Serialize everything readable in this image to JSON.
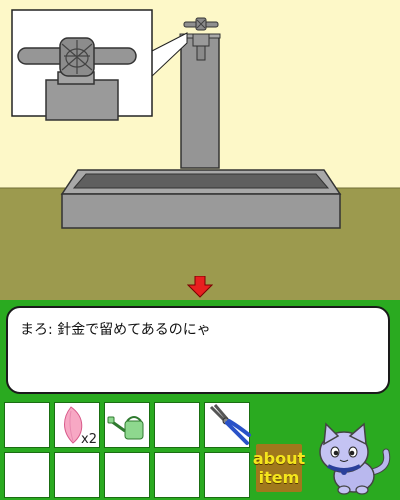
{
  "dialog": {
    "text": "まろ: 針金で留めてあるのにゃ"
  },
  "nav": {
    "down_arrow_icon": "red-down-arrow-icon"
  },
  "inventory": {
    "slots": [
      {
        "item": "empty"
      },
      {
        "item": "pink-petal",
        "count": "x2"
      },
      {
        "item": "watering-can"
      },
      {
        "item": "empty"
      },
      {
        "item": "pliers"
      },
      {
        "item": "empty"
      },
      {
        "item": "empty"
      },
      {
        "item": "empty"
      },
      {
        "item": "empty"
      },
      {
        "item": "empty"
      }
    ]
  },
  "about_item": {
    "line1": "about",
    "line2": "item"
  },
  "colors": {
    "wall": "#fdf8c8",
    "floor": "#9c9a4e",
    "hud_background": "#2aaa20",
    "arrow": "#e82020",
    "about_item_bg": "#a0781c",
    "about_item_text": "#f5e61c"
  }
}
